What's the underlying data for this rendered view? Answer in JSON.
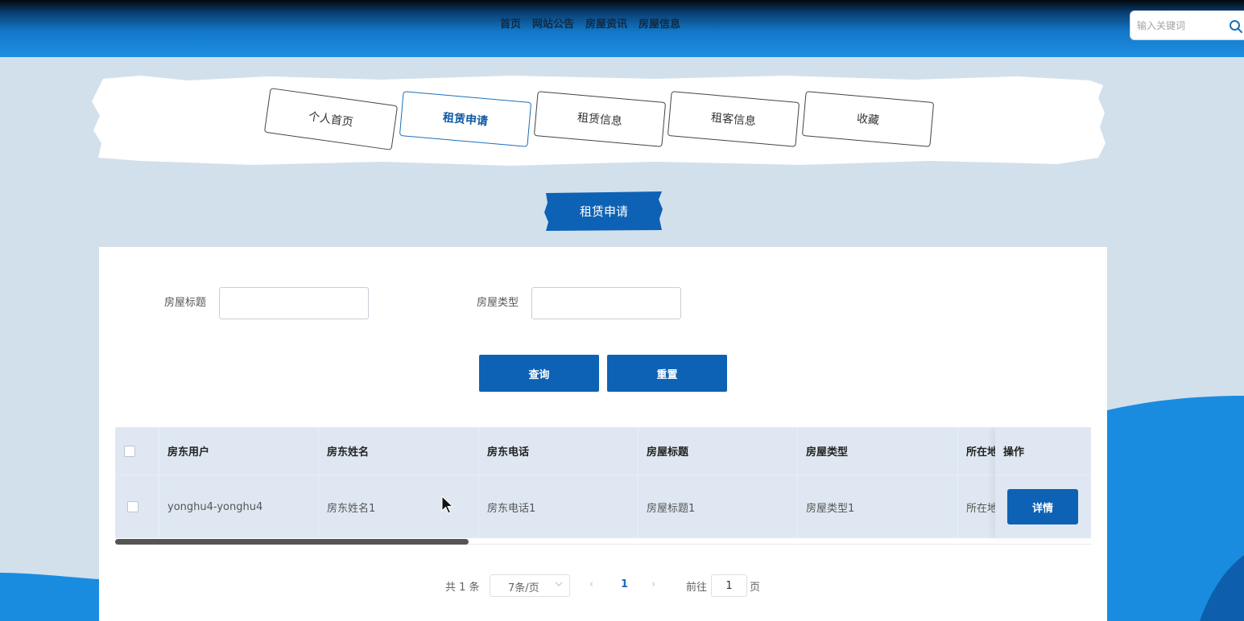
{
  "header": {
    "nav": [
      "首页",
      "网站公告",
      "房屋资讯",
      "房屋信息"
    ],
    "search": {
      "placeholder": "输入关键词",
      "value": ""
    }
  },
  "tabs": [
    {
      "label": "个人首页",
      "active": false
    },
    {
      "label": "租赁申请",
      "active": true
    },
    {
      "label": "租赁信息",
      "active": false
    },
    {
      "label": "租客信息",
      "active": false
    },
    {
      "label": "收藏",
      "active": false
    }
  ],
  "section_title": "租赁申请",
  "filters": {
    "title_label": "房屋标题",
    "title_value": "",
    "type_label": "房屋类型",
    "type_value": "",
    "query_button": "查询",
    "reset_button": "重置"
  },
  "table": {
    "columns": [
      "房东用户",
      "房东姓名",
      "房东电话",
      "房屋标题",
      "房屋类型",
      "所在地"
    ],
    "action_column": "操作",
    "rows": [
      {
        "cells": [
          "yonghu4-yonghu4",
          "房东姓名1",
          "房东电话1",
          "房屋标题1",
          "房屋类型1",
          "所在地"
        ],
        "action_label": "详情"
      }
    ]
  },
  "pagination": {
    "total_text": "共 1 条",
    "page_size": "7条/页",
    "prev": "‹",
    "current_page": "1",
    "next": "›",
    "goto_label": "前往",
    "goto_value": "1",
    "page_unit": "页"
  },
  "colors": {
    "primary": "#0d62b5",
    "header_top": "#02070c",
    "header_bottom": "#1e8fe2",
    "background": "#d2e0ec"
  }
}
